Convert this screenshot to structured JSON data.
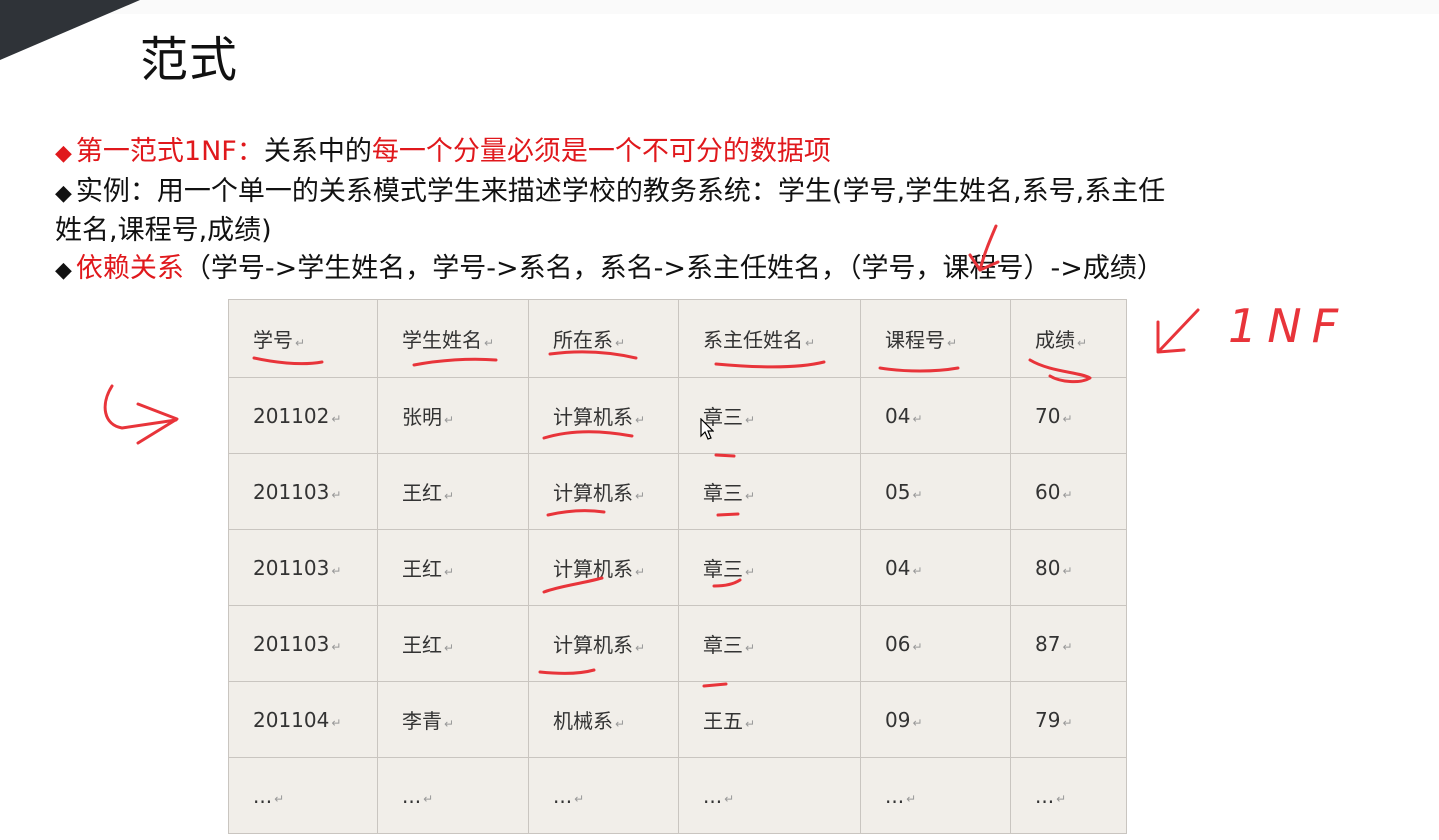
{
  "slide": {
    "title": "范式",
    "line1": {
      "bullet": "◆",
      "red_lead": "第一范式1NF：",
      "text": "关系中的",
      "red_emph": "每一个分量必须是一个不可分的数据项"
    },
    "line2": {
      "bullet": "◆",
      "text": "实例：用一个单一的关系模式学生来描述学校的教务系统：学生(学号,学生姓名,系号,系主任"
    },
    "line3": {
      "text": "姓名,课程号,成绩)"
    },
    "line4": {
      "bullet": "◆",
      "red_lead": "依赖关系",
      "text": "（学号->学生姓名，学号->系名，系名->系主任姓名，（学号，课程号）->成绩）"
    },
    "annotation_text": "1NF"
  },
  "table": {
    "headers": [
      "学号",
      "学生姓名",
      "所在系",
      "系主任姓名",
      "课程号",
      "成绩"
    ],
    "rows": [
      [
        "201102",
        "张明",
        "计算机系",
        "章三",
        "04",
        "70"
      ],
      [
        "201103",
        "王红",
        "计算机系",
        "章三",
        "05",
        "60"
      ],
      [
        "201103",
        "王红",
        "计算机系",
        "章三",
        "04",
        "80"
      ],
      [
        "201103",
        "王红",
        "计算机系",
        "章三",
        "06",
        "87"
      ],
      [
        "201104",
        "李青",
        "机械系",
        "王五",
        "09",
        "79"
      ],
      [
        "...",
        "...",
        "...",
        "...",
        "...",
        "..."
      ]
    ],
    "cell_mark": "↵"
  },
  "colors": {
    "emphasis": "#e0181c",
    "ink": "#e8343a",
    "cell_bg": "#f1eee9"
  }
}
